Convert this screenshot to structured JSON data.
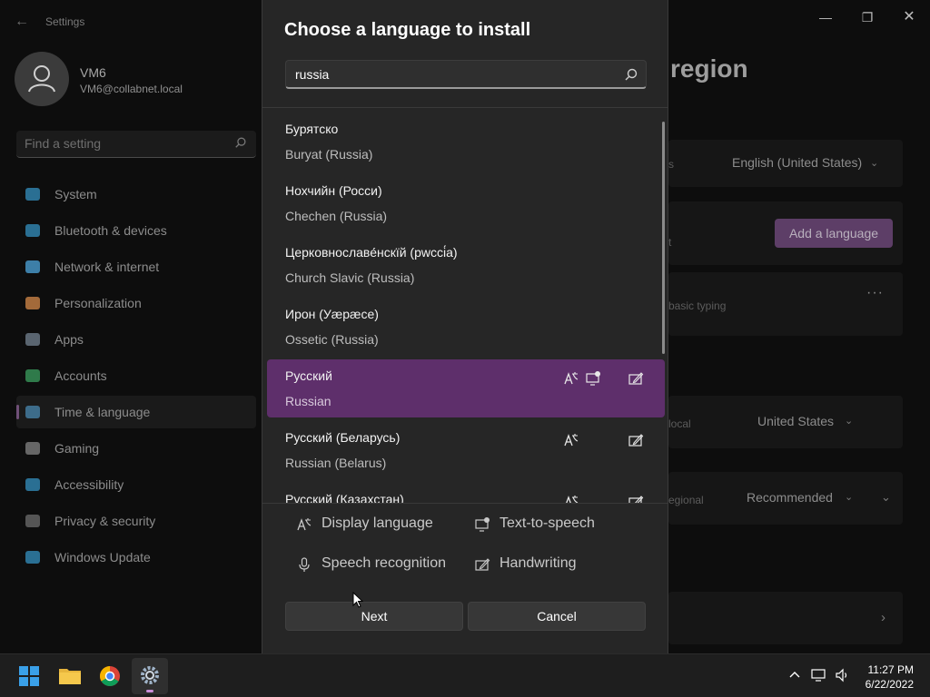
{
  "settings": {
    "app_title": "Settings",
    "back_icon": "back-arrow-icon",
    "user": {
      "name": "VM6",
      "email": "VM6@collabnet.local"
    },
    "search_placeholder": "Find a setting",
    "nav": [
      {
        "label": "System",
        "icon": "monitor-icon",
        "color": "#2a6f93"
      },
      {
        "label": "Bluetooth & devices",
        "icon": "bluetooth-icon",
        "color": "#2a6f93"
      },
      {
        "label": "Network & internet",
        "icon": "wifi-icon",
        "color": "#3d7fa8"
      },
      {
        "label": "Personalization",
        "icon": "brush-icon",
        "color": "#a36a3a"
      },
      {
        "label": "Apps",
        "icon": "apps-icon",
        "color": "#5a6570"
      },
      {
        "label": "Accounts",
        "icon": "person-icon",
        "color": "#2f7a4a"
      },
      {
        "label": "Time & language",
        "icon": "clock-globe-icon",
        "color": "#3d6c8a"
      },
      {
        "label": "Gaming",
        "icon": "gamepad-icon",
        "color": "#666666"
      },
      {
        "label": "Accessibility",
        "icon": "accessibility-icon",
        "color": "#2a6f93"
      },
      {
        "label": "Privacy & security",
        "icon": "shield-icon",
        "color": "#555555"
      },
      {
        "label": "Windows Update",
        "icon": "update-icon",
        "color": "#2a6f93"
      }
    ],
    "active_nav": "Time & language",
    "content": {
      "title_fragment": "region",
      "display_language_value": "English (United States)",
      "partial_s": "s",
      "partial_t": "t",
      "add_language_label": "Add a language",
      "basic_typing": "basic typing",
      "more_icon": "ellipsis-icon",
      "local_text": "local",
      "country_value": "United States",
      "regional_text": "egional",
      "regional_value": "Recommended"
    },
    "window_controls": {
      "minimize": "minimize-icon",
      "maximize": "restore-icon",
      "close": "close-icon"
    }
  },
  "dialog": {
    "title": "Choose a language to install",
    "search_value": "russia",
    "search_icon": "search-icon",
    "languages": [
      {
        "native": "Бурятско",
        "english": "Buryat (Russia)",
        "features": [],
        "selected": false
      },
      {
        "native": "Нохчийн (Росси)",
        "english": "Chechen (Russia)",
        "features": [],
        "selected": false
      },
      {
        "native": "Церковнославе́нскїй (рwссі́а)",
        "english": "Church Slavic (Russia)",
        "features": [],
        "selected": false
      },
      {
        "native": "Ирон (Уæрæсе)",
        "english": "Ossetic (Russia)",
        "features": [],
        "selected": false
      },
      {
        "native": "Русский",
        "english": "Russian",
        "features": [
          "display-language-icon",
          "text-to-speech-icon",
          "handwriting-icon"
        ],
        "selected": true
      },
      {
        "native": "Русский (Беларусь)",
        "english": "Russian (Belarus)",
        "features": [
          "display-language-icon",
          "handwriting-icon"
        ],
        "selected": false
      },
      {
        "native": "Русский (Казахстан)",
        "english": "",
        "features": [
          "display-language-icon",
          "handwriting-icon"
        ],
        "selected": false
      }
    ],
    "legend": [
      {
        "label": "Display language",
        "icon": "display-language-icon"
      },
      {
        "label": "Text-to-speech",
        "icon": "text-to-speech-icon"
      },
      {
        "label": "Speech recognition",
        "icon": "microphone-icon"
      },
      {
        "label": "Handwriting",
        "icon": "handwriting-icon"
      }
    ],
    "next_label": "Next",
    "cancel_label": "Cancel"
  },
  "taskbar": {
    "apps": [
      {
        "name": "start-icon",
        "active": false
      },
      {
        "name": "file-explorer-icon",
        "active": false
      },
      {
        "name": "chrome-icon",
        "active": false
      },
      {
        "name": "settings-gear-icon",
        "active": true
      }
    ],
    "tray_icons": [
      "chevron-up-icon",
      "network-icon",
      "volume-icon"
    ],
    "time": "11:27 PM",
    "date": "6/22/2022"
  }
}
